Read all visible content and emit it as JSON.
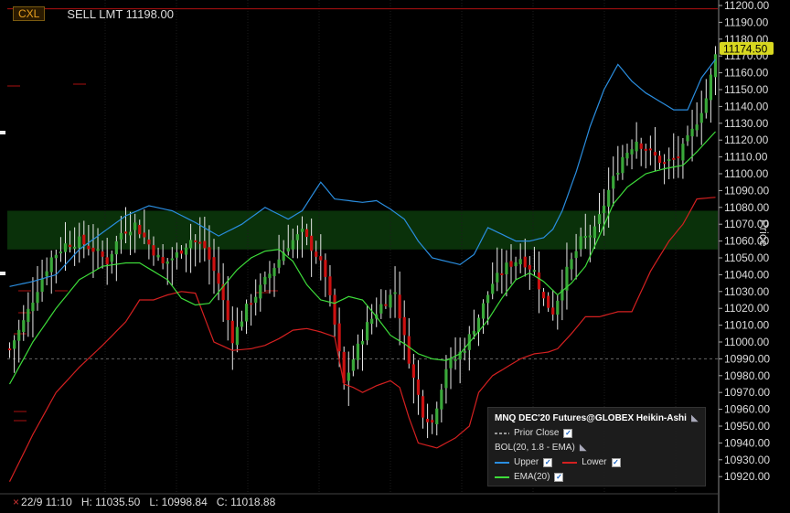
{
  "order": {
    "cancel_label": "CXL",
    "text": "SELL LMT 11198.00",
    "price": 11198
  },
  "price_axis": {
    "title": "Price",
    "ticks": [
      11200,
      11190,
      11180,
      11170,
      11160,
      11150,
      11140,
      11130,
      11120,
      11110,
      11100,
      11090,
      11080,
      11070,
      11060,
      11050,
      11040,
      11030,
      11020,
      11010,
      11000,
      10990,
      10980,
      10970,
      10960,
      10950,
      10940,
      10930,
      10920
    ],
    "tick_labels": [
      "11200.00",
      "11190.00",
      "11180.00",
      "11170.00",
      "11160.00",
      "11150.00",
      "11140.00",
      "11130.00",
      "11120.00",
      "11110.00",
      "11100.00",
      "11090.00",
      "11080.00",
      "11070.00",
      "11060.00",
      "11050.00",
      "11040.00",
      "11030.00",
      "11020.00",
      "11010.00",
      "11000.00",
      "10990.00",
      "10980.00",
      "10970.00",
      "10960.00",
      "10950.00",
      "10940.00",
      "10930.00",
      "10920.00"
    ],
    "last_price_label": "11174.50",
    "last_price": 11174.5
  },
  "ohlc": {
    "date": "22/9 11:10",
    "high": "H: 11035.50",
    "low": "L: 10998.84",
    "close": "C: 11018.88"
  },
  "legend": {
    "title": "MNQ DEC'20 Futures@GLOBEX Heikin-Ashi",
    "prior_close": "Prior Close",
    "bol": "BOL(20, 1.8 - EMA)",
    "upper": "Upper",
    "lower": "Lower",
    "ema": "EMA(20)"
  },
  "colors": {
    "up": "#3aa83a",
    "down": "#cc1111",
    "upper": "#2a8ee0",
    "lower": "#d42020",
    "ema": "#3ddc3a",
    "zone": "#0c3a0c",
    "last_price_bg": "#d8d820"
  },
  "chart_data": {
    "type": "candlestick",
    "style": "Heikin-Ashi",
    "instrument": "MNQ DEC'20",
    "ylim": [
      10912,
      11204
    ],
    "zone": [
      11055,
      11078
    ],
    "prior_close": 10990,
    "anchors": {
      "upper": [
        [
          0,
          11033
        ],
        [
          5,
          11036
        ],
        [
          10,
          11040
        ],
        [
          15,
          11055
        ],
        [
          20,
          11065
        ],
        [
          25,
          11075
        ],
        [
          30,
          11081
        ],
        [
          35,
          11078
        ],
        [
          40,
          11071
        ],
        [
          45,
          11063
        ],
        [
          50,
          11070
        ],
        [
          55,
          11080
        ],
        [
          60,
          11073
        ],
        [
          63,
          11078
        ],
        [
          67,
          11095
        ],
        [
          70,
          11085
        ],
        [
          73,
          11084
        ],
        [
          76,
          11083
        ],
        [
          79,
          11084
        ],
        [
          82,
          11079
        ],
        [
          85,
          11073
        ],
        [
          88,
          11060
        ],
        [
          91,
          11050
        ],
        [
          94,
          11048
        ],
        [
          97,
          11046
        ],
        [
          100,
          11052
        ],
        [
          103,
          11068
        ],
        [
          106,
          11064
        ],
        [
          109,
          11060
        ],
        [
          112,
          11060
        ],
        [
          115,
          11062
        ],
        [
          117,
          11067
        ],
        [
          119,
          11078
        ],
        [
          122,
          11101
        ],
        [
          125,
          11128
        ],
        [
          128,
          11150
        ],
        [
          131,
          11165
        ],
        [
          134,
          11155
        ],
        [
          137,
          11148
        ],
        [
          140,
          11143
        ],
        [
          143,
          11138
        ],
        [
          146,
          11138
        ],
        [
          149,
          11157
        ],
        [
          152,
          11168
        ]
      ],
      "lower": [
        [
          0,
          10917
        ],
        [
          5,
          10945
        ],
        [
          10,
          10970
        ],
        [
          15,
          10985
        ],
        [
          20,
          10998
        ],
        [
          25,
          11012
        ],
        [
          28,
          11025
        ],
        [
          31,
          11025
        ],
        [
          34,
          11028
        ],
        [
          37,
          11030
        ],
        [
          40,
          11029
        ],
        [
          44,
          11000
        ],
        [
          48,
          10995
        ],
        [
          52,
          10996
        ],
        [
          55,
          10998
        ],
        [
          58,
          11002
        ],
        [
          61,
          11007
        ],
        [
          64,
          11008
        ],
        [
          67,
          11006
        ],
        [
          70,
          11003
        ],
        [
          72,
          10975
        ],
        [
          74,
          10973
        ],
        [
          76,
          10970
        ],
        [
          79,
          10974
        ],
        [
          82,
          10977
        ],
        [
          84,
          10973
        ],
        [
          86,
          10955
        ],
        [
          88,
          10940
        ],
        [
          92,
          10937
        ],
        [
          96,
          10943
        ],
        [
          99,
          10950
        ],
        [
          101,
          10970
        ],
        [
          104,
          10980
        ],
        [
          107,
          10985
        ],
        [
          110,
          10990
        ],
        [
          113,
          10993
        ],
        [
          116,
          10994
        ],
        [
          118,
          10996
        ],
        [
          121,
          11005
        ],
        [
          124,
          11015
        ],
        [
          127,
          11015
        ],
        [
          131,
          11018
        ],
        [
          134,
          11018
        ],
        [
          138,
          11042
        ],
        [
          142,
          11060
        ],
        [
          145,
          11070
        ],
        [
          148,
          11085
        ],
        [
          152,
          11086
        ]
      ],
      "ema": [
        [
          0,
          10975
        ],
        [
          5,
          11000
        ],
        [
          10,
          11020
        ],
        [
          15,
          11037
        ],
        [
          20,
          11045
        ],
        [
          25,
          11047
        ],
        [
          28,
          11047
        ],
        [
          31,
          11042
        ],
        [
          34,
          11037
        ],
        [
          37,
          11026
        ],
        [
          40,
          11022
        ],
        [
          43,
          11023
        ],
        [
          46,
          11033
        ],
        [
          49,
          11043
        ],
        [
          52,
          11050
        ],
        [
          55,
          11054
        ],
        [
          58,
          11055
        ],
        [
          61,
          11048
        ],
        [
          64,
          11034
        ],
        [
          67,
          11025
        ],
        [
          70,
          11023
        ],
        [
          73,
          11027
        ],
        [
          76,
          11025
        ],
        [
          79,
          11015
        ],
        [
          82,
          11004
        ],
        [
          85,
          10999
        ],
        [
          88,
          10993
        ],
        [
          91,
          10990
        ],
        [
          94,
          10989
        ],
        [
          97,
          10993
        ],
        [
          100,
          11003
        ],
        [
          103,
          11013
        ],
        [
          106,
          11026
        ],
        [
          109,
          11037
        ],
        [
          112,
          11041
        ],
        [
          115,
          11036
        ],
        [
          118,
          11028
        ],
        [
          121,
          11035
        ],
        [
          124,
          11045
        ],
        [
          127,
          11063
        ],
        [
          130,
          11082
        ],
        [
          133,
          11092
        ],
        [
          137,
          11100
        ],
        [
          141,
          11103
        ],
        [
          145,
          11105
        ],
        [
          148,
          11113
        ],
        [
          152,
          11125
        ]
      ],
      "price": [
        [
          0,
          10996
        ],
        [
          3,
          11012
        ],
        [
          6,
          11032
        ],
        [
          9,
          11050
        ],
        [
          12,
          11058
        ],
        [
          15,
          11060
        ],
        [
          18,
          11055
        ],
        [
          21,
          11048
        ],
        [
          24,
          11065
        ],
        [
          27,
          11070
        ],
        [
          30,
          11058
        ],
        [
          33,
          11046
        ],
        [
          36,
          11052
        ],
        [
          39,
          11061
        ],
        [
          42,
          11056
        ],
        [
          45,
          11035
        ],
        [
          48,
          11002
        ],
        [
          51,
          11020
        ],
        [
          54,
          11032
        ],
        [
          57,
          11045
        ],
        [
          60,
          11058
        ],
        [
          63,
          11065
        ],
        [
          66,
          11052
        ],
        [
          68,
          11040
        ],
        [
          70,
          11010
        ],
        [
          72,
          10975
        ],
        [
          74,
          10990
        ],
        [
          77,
          11010
        ],
        [
          80,
          11022
        ],
        [
          83,
          11030
        ],
        [
          85,
          11002
        ],
        [
          87,
          10978
        ],
        [
          89,
          10958
        ],
        [
          91,
          10952
        ],
        [
          94,
          10985
        ],
        [
          96,
          10990
        ],
        [
          98,
          10997
        ],
        [
          101,
          11015
        ],
        [
          104,
          11035
        ],
        [
          107,
          11045
        ],
        [
          110,
          11050
        ],
        [
          113,
          11042
        ],
        [
          115,
          11025
        ],
        [
          117,
          11018
        ],
        [
          120,
          11042
        ],
        [
          123,
          11060
        ],
        [
          126,
          11066
        ],
        [
          129,
          11090
        ],
        [
          132,
          11110
        ],
        [
          135,
          11120
        ],
        [
          138,
          11112
        ],
        [
          141,
          11106
        ],
        [
          144,
          11110
        ],
        [
          147,
          11125
        ],
        [
          150,
          11145
        ],
        [
          152,
          11170
        ]
      ]
    }
  }
}
